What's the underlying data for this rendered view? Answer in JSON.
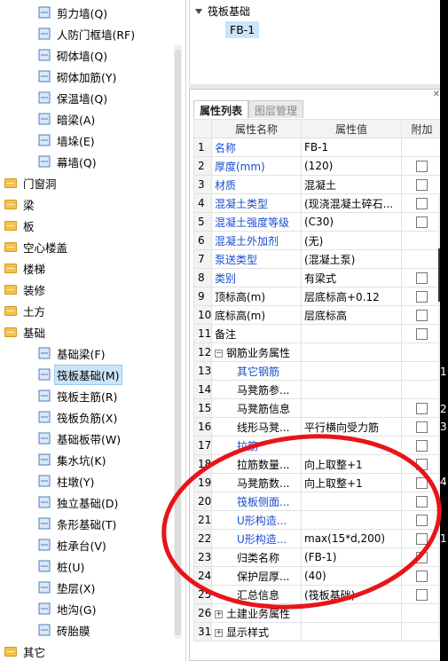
{
  "left_tree": {
    "items": [
      {
        "label": "剪力墙(Q)",
        "type": "leaf",
        "icon": "shear-wall-icon"
      },
      {
        "label": "人防门框墙(RF)",
        "type": "leaf",
        "icon": "civil-defense-door-icon"
      },
      {
        "label": "砌体墙(Q)",
        "type": "leaf",
        "icon": "masonry-wall-icon"
      },
      {
        "label": "砌体加筋(Y)",
        "type": "leaf",
        "icon": "masonry-rebar-icon"
      },
      {
        "label": "保温墙(Q)",
        "type": "leaf",
        "icon": "insulation-wall-icon"
      },
      {
        "label": "暗梁(A)",
        "type": "leaf",
        "icon": "hidden-beam-icon"
      },
      {
        "label": "墙垛(E)",
        "type": "leaf",
        "icon": "wall-pier-icon"
      },
      {
        "label": "幕墙(Q)",
        "type": "leaf",
        "icon": "curtain-wall-icon"
      },
      {
        "label": "门窗洞",
        "type": "group"
      },
      {
        "label": "梁",
        "type": "group"
      },
      {
        "label": "板",
        "type": "group"
      },
      {
        "label": "空心楼盖",
        "type": "group"
      },
      {
        "label": "楼梯",
        "type": "group"
      },
      {
        "label": "装修",
        "type": "group"
      },
      {
        "label": "土方",
        "type": "group"
      },
      {
        "label": "基础",
        "type": "group"
      },
      {
        "label": "基础梁(F)",
        "type": "leaf",
        "icon": "foundation-beam-icon"
      },
      {
        "label": "筏板基础(M)",
        "type": "leaf",
        "icon": "raft-foundation-icon",
        "selected": true
      },
      {
        "label": "筏板主筋(R)",
        "type": "leaf",
        "icon": "raft-main-rebar-icon"
      },
      {
        "label": "筏板负筋(X)",
        "type": "leaf",
        "icon": "raft-negative-rebar-icon"
      },
      {
        "label": "基础板带(W)",
        "type": "leaf",
        "icon": "foundation-strip-icon"
      },
      {
        "label": "集水坑(K)",
        "type": "leaf",
        "icon": "sump-pit-icon"
      },
      {
        "label": "柱墩(Y)",
        "type": "leaf",
        "icon": "column-pier-icon"
      },
      {
        "label": "独立基础(D)",
        "type": "leaf",
        "icon": "isolated-footing-icon"
      },
      {
        "label": "条形基础(T)",
        "type": "leaf",
        "icon": "strip-footing-icon"
      },
      {
        "label": "桩承台(V)",
        "type": "leaf",
        "icon": "pile-cap-icon"
      },
      {
        "label": "桩(U)",
        "type": "leaf",
        "icon": "pile-icon"
      },
      {
        "label": "垫层(X)",
        "type": "leaf",
        "icon": "cushion-layer-icon"
      },
      {
        "label": "地沟(G)",
        "type": "leaf",
        "icon": "trench-icon"
      },
      {
        "label": "砖胎膜",
        "type": "leaf",
        "icon": "brick-mold-icon"
      },
      {
        "label": "其它",
        "type": "group"
      }
    ]
  },
  "component_tree": {
    "root": "筏板基础",
    "child": "FB-1"
  },
  "properties": {
    "tabs": [
      "属性列表",
      "图层管理"
    ],
    "headers": [
      "",
      "属性名称",
      "属性值",
      "附加"
    ],
    "rows": [
      {
        "n": "1",
        "name": "名称",
        "value": "FB-1",
        "blue": true,
        "check": false
      },
      {
        "n": "2",
        "name": "厚度(mm)",
        "value": "(120)",
        "blue": true,
        "check": true
      },
      {
        "n": "3",
        "name": "材质",
        "value": "混凝土",
        "blue": true,
        "check": true
      },
      {
        "n": "4",
        "name": "混凝土类型",
        "value": "(现浇混凝土碎石...",
        "blue": true,
        "check": true
      },
      {
        "n": "5",
        "name": "混凝土强度等级",
        "value": "(C30)",
        "blue": true,
        "check": true
      },
      {
        "n": "6",
        "name": "混凝土外加剂",
        "value": "(无)",
        "blue": true,
        "check": false
      },
      {
        "n": "7",
        "name": "泵送类型",
        "value": "(混凝土泵)",
        "blue": true,
        "check": false
      },
      {
        "n": "8",
        "name": "类别",
        "value": "有梁式",
        "blue": true,
        "check": true
      },
      {
        "n": "9",
        "name": "顶标高(m)",
        "value": "层底标高+0.12",
        "blue": false,
        "check": true
      },
      {
        "n": "10",
        "name": "底标高(m)",
        "value": "层底标高",
        "blue": false,
        "check": true
      },
      {
        "n": "11",
        "name": "备注",
        "value": "",
        "blue": false,
        "check": true
      },
      {
        "n": "12",
        "name": "钢筋业务属性",
        "value": "",
        "blue": false,
        "check": false,
        "group": "minus"
      },
      {
        "n": "13",
        "name": "其它钢筋",
        "value": "",
        "blue": true,
        "check": false,
        "indent": true
      },
      {
        "n": "14",
        "name": "马凳筋参...",
        "value": "",
        "blue": false,
        "check": false,
        "indent": true
      },
      {
        "n": "15",
        "name": "马凳筋信息",
        "value": "",
        "blue": false,
        "check": true,
        "indent": true
      },
      {
        "n": "16",
        "name": "线形马凳...",
        "value": "平行横向受力筋",
        "blue": false,
        "check": true,
        "indent": true
      },
      {
        "n": "17",
        "name": "拉筋",
        "value": "",
        "blue": true,
        "check": true,
        "indent": true
      },
      {
        "n": "18",
        "name": "拉筋数量...",
        "value": "向上取整+1",
        "blue": false,
        "check": true,
        "indent": true
      },
      {
        "n": "19",
        "name": "马凳筋数...",
        "value": "向上取整+1",
        "blue": false,
        "check": true,
        "indent": true
      },
      {
        "n": "20",
        "name": "筏板侧面...",
        "value": "",
        "blue": true,
        "check": true,
        "indent": true
      },
      {
        "n": "21",
        "name": "U形构造...",
        "value": "",
        "blue": true,
        "check": true,
        "indent": true
      },
      {
        "n": "22",
        "name": "U形构造...",
        "value": "max(15*d,200)",
        "blue": true,
        "check": true,
        "indent": true
      },
      {
        "n": "23",
        "name": "归类名称",
        "value": "(FB-1)",
        "blue": false,
        "check": true,
        "indent": true
      },
      {
        "n": "24",
        "name": "保护层厚...",
        "value": "(40)",
        "blue": false,
        "check": true,
        "indent": true
      },
      {
        "n": "25",
        "name": "汇总信息",
        "value": "(筏板基础)",
        "blue": false,
        "check": true,
        "indent": true
      },
      {
        "n": "26",
        "name": "土建业务属性",
        "value": "",
        "blue": false,
        "check": false,
        "group": "plus"
      },
      {
        "n": "31",
        "name": "显示样式",
        "value": "",
        "blue": false,
        "check": false,
        "group": "plus"
      }
    ]
  },
  "canvas_numbers": [
    "1",
    "2",
    "3",
    "4",
    "1"
  ],
  "colors": {
    "annotation": "#e8141b",
    "selected_bg": "#cce4f7",
    "blue_text": "#1a4dd0"
  }
}
